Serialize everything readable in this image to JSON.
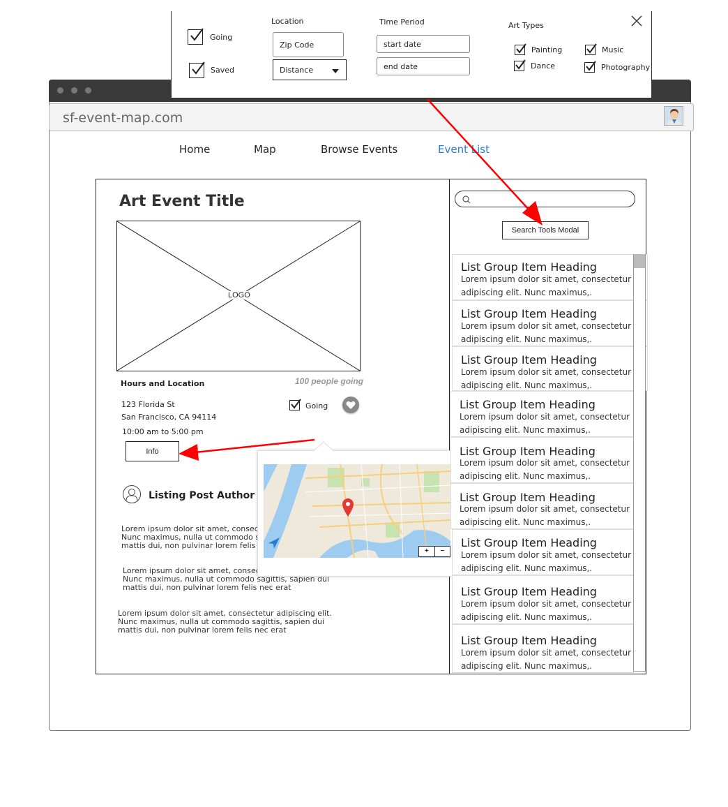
{
  "browser": {
    "url": "sf-event-map.com"
  },
  "nav": {
    "items": [
      {
        "label": "Home",
        "active": false
      },
      {
        "label": "Map",
        "active": false
      },
      {
        "label": "Browse Events",
        "active": false
      },
      {
        "label": "Event List",
        "active": true
      }
    ],
    "active_color": "#2a7bd4"
  },
  "event": {
    "title": "Art Event Title",
    "logo_label": "LOGO",
    "hours_title": "Hours and Location",
    "people_going": "100 people going",
    "address_line1": "123  Florida St",
    "address_line2": "San Francisco, CA 94114",
    "hours": "10:00 am to 5:00 pm",
    "going_label": "Going",
    "going_checked": true,
    "info_label": "Info",
    "author_label": "Listing Post Author",
    "paragraphs": [
      "Lorem ipsum dolor sit amet, consectetur adipiscing elit. Nunc maximus, nulla ut commodo sagittis, sapien dui mattis dui, non pulvinar lorem felis nec erat",
      "Lorem ipsum dolor sit amet, consectetur adipiscing elit. Nunc maximus, nulla ut commodo sagittis, sapien dui mattis dui, non pulvinar lorem felis nec erat",
      "Lorem ipsum dolor sit amet, consectetur adipiscing elit. Nunc maximus, nulla ut commodo sagittis, sapien dui mattis dui, non pulvinar lorem felis nec erat"
    ]
  },
  "map": {
    "zoom_in": "+",
    "zoom_out": "−"
  },
  "sidebar": {
    "search_placeholder": "",
    "search_tools_label": "Search Tools Modal",
    "list_items": [
      {
        "heading": "List Group Item Heading",
        "line1": "Lorem ipsum dolor sit amet, consectetur",
        "line2": "adipiscing elit. Nunc maximus,."
      },
      {
        "heading": "List Group Item Heading",
        "line1": "Lorem ipsum dolor sit amet, consectetur",
        "line2": "adipiscing elit. Nunc maximus,."
      },
      {
        "heading": "List Group Item Heading",
        "line1": "Lorem ipsum dolor sit amet, consectetur",
        "line2": "adipiscing elit. Nunc maximus,."
      },
      {
        "heading": "List Group Item Heading",
        "line1": "Lorem ipsum dolor sit amet, consectetur",
        "line2": "adipiscing elit. Nunc maximus,."
      },
      {
        "heading": "List Group Item Heading",
        "line1": "Lorem ipsum dolor sit amet, consectetur",
        "line2": "adipiscing elit. Nunc maximus,."
      },
      {
        "heading": "List Group Item Heading",
        "line1": "Lorem ipsum dolor sit amet, consectetur",
        "line2": "adipiscing elit. Nunc maximus,."
      },
      {
        "heading": "List Group Item Heading",
        "line1": "Lorem ipsum dolor sit amet, consectetur",
        "line2": "adipiscing elit. Nunc maximus,."
      },
      {
        "heading": "List Group Item Heading",
        "line1": "Lorem ipsum dolor sit amet, consectetur",
        "line2": "adipiscing elit. Nunc maximus,."
      },
      {
        "heading": "List Group Item Heading",
        "line1": "Lorem ipsum dolor sit amet, consectetur",
        "line2": "adipiscing elit. Nunc maximus,."
      }
    ]
  },
  "modal": {
    "going_label": "Going",
    "saved_label": "Saved",
    "going_checked": true,
    "saved_checked": true,
    "location_label": "Location",
    "zip_placeholder": "Zip Code",
    "distance_label": "Distance",
    "time_label": "Time Period",
    "start_placeholder": "start date",
    "end_placeholder": "end date",
    "art_types_label": "Art Types",
    "art_types": [
      {
        "label": "Painting",
        "checked": true
      },
      {
        "label": "Music",
        "checked": true
      },
      {
        "label": "Dance",
        "checked": true
      },
      {
        "label": "Photography",
        "checked": true
      }
    ]
  },
  "annotation_color": "#ff0000"
}
